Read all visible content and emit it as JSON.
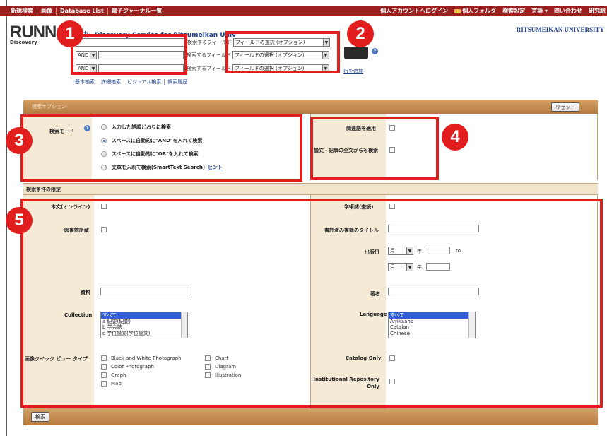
{
  "topnav": {
    "left": [
      "新規検索",
      "画像",
      "Database List",
      "電子ジャーナル一覧"
    ],
    "right": [
      "個人アカウントへログイン",
      "個人フォルダ",
      "検索設定",
      "言語 ▾",
      "問い合わせ",
      "研究総"
    ]
  },
  "header": {
    "logo": "RUNN",
    "logo_sub": "Discovery",
    "searching": "中：Discovery Service for Ritsumeikan Univ",
    "university": "RITSUMEIKAN UNIVERSITY"
  },
  "search": {
    "rows": [
      {
        "bool": "",
        "term": "",
        "field_label": "検索するフィールド",
        "field": "フィールドの選択 (オプション)"
      },
      {
        "bool": "AND",
        "term": "",
        "field_label": "検索するフィールド",
        "field": "フィールドの選択 (オプション)"
      },
      {
        "bool": "AND",
        "term": "",
        "field_label": "検索するフィールド",
        "field": "フィールドの選択 (オプション)"
      }
    ],
    "add_row": "行を追加",
    "links": [
      "基本検索",
      "詳細検索",
      "ビジュアル検索",
      "検索履歴"
    ]
  },
  "options": {
    "title": "検索オプション",
    "reset": "リセット",
    "mode_label": "検索モード",
    "modes": [
      {
        "label": "入力した語順どおりに検索",
        "selected": false
      },
      {
        "label": "スペースに自動的に\"AND\"を入れて検索",
        "selected": true
      },
      {
        "label": "スペースに自動的に\"OR\"を入れて検索",
        "selected": false
      },
      {
        "label": "文章を入れて検索(SmartText Search)",
        "selected": false
      }
    ],
    "hint": "ヒント",
    "related_label": "関連語を適用",
    "fulltext_label": "論文・記事の全文からも検索"
  },
  "limits": {
    "title": "検索条件の限定",
    "fulltext": "本文(オンライン)",
    "library": "図書館所蔵",
    "material": "資料",
    "collection_label": "Collection",
    "collection_items": [
      "すべて",
      "a 紀要(紀要)",
      "b 学会誌",
      "c 学位論文(学位論文)"
    ],
    "image_label": "画像クイック ビュー タイプ",
    "image_col1": [
      "Black and White Photograph",
      "Color Photograph",
      "Graph",
      "Map"
    ],
    "image_col2": [
      "Chart",
      "Diagram",
      "Illustration"
    ],
    "peer": "学術誌(査読)",
    "reviewed_title": "書評済み書籍のタイトル",
    "pubdate": "出版日",
    "month": "月",
    "year": "年:",
    "to": "to",
    "author": "著者",
    "language_label": "Language",
    "language_items": [
      "すべて",
      "Afrikaans",
      "Catalan",
      "Chinese"
    ],
    "catalog_only": "Catalog Only",
    "repository_only": "Institutional Repository Only"
  },
  "footer": {
    "search": "検索"
  },
  "badges": [
    "1",
    "2",
    "3",
    "4",
    "5"
  ],
  "colors": {
    "topbar": "#9b1f1f",
    "panel": "#c48a4e",
    "annotation": "#e21d1d",
    "link": "#1e3f8c"
  }
}
